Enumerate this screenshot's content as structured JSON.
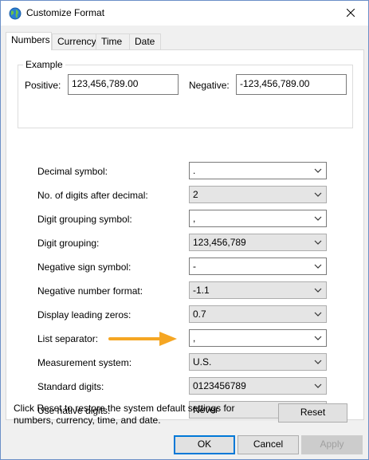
{
  "window": {
    "title": "Customize Format"
  },
  "tabs": [
    {
      "label": "Numbers",
      "active": true
    },
    {
      "label": "Currency",
      "active": false
    },
    {
      "label": "Time",
      "active": false
    },
    {
      "label": "Date",
      "active": false
    }
  ],
  "example": {
    "legend": "Example",
    "positive_label": "Positive:",
    "positive_value": "123,456,789.00",
    "negative_label": "Negative:",
    "negative_value": "-123,456,789.00"
  },
  "settings": [
    {
      "label": "Decimal symbol:",
      "value": ".",
      "editable": true
    },
    {
      "label": "No. of digits after decimal:",
      "value": "2",
      "editable": false
    },
    {
      "label": "Digit grouping symbol:",
      "value": ",",
      "editable": true
    },
    {
      "label": "Digit grouping:",
      "value": "123,456,789",
      "editable": false
    },
    {
      "label": "Negative sign symbol:",
      "value": "-",
      "editable": true
    },
    {
      "label": "Negative number format:",
      "value": "-1.1",
      "editable": false
    },
    {
      "label": "Display leading zeros:",
      "value": "0.7",
      "editable": false
    },
    {
      "label": "List separator:",
      "value": ",",
      "editable": true
    },
    {
      "label": "Measurement system:",
      "value": "U.S.",
      "editable": false
    },
    {
      "label": "Standard digits:",
      "value": "0123456789",
      "editable": false
    },
    {
      "label": "Use native digits:",
      "value": "Never",
      "editable": false
    }
  ],
  "reset_text": "Click Reset to restore the system default settings for numbers, currency, time, and date.",
  "buttons": {
    "reset": "Reset",
    "ok": "OK",
    "cancel": "Cancel",
    "apply": "Apply"
  },
  "colors": {
    "accent": "#0078d7",
    "annotation_arrow": "#f5a623"
  },
  "icons": {
    "app": "globe-icon",
    "close": "close-icon",
    "combo": "chevron-down-icon",
    "annotation": "arrow-right-icon"
  }
}
